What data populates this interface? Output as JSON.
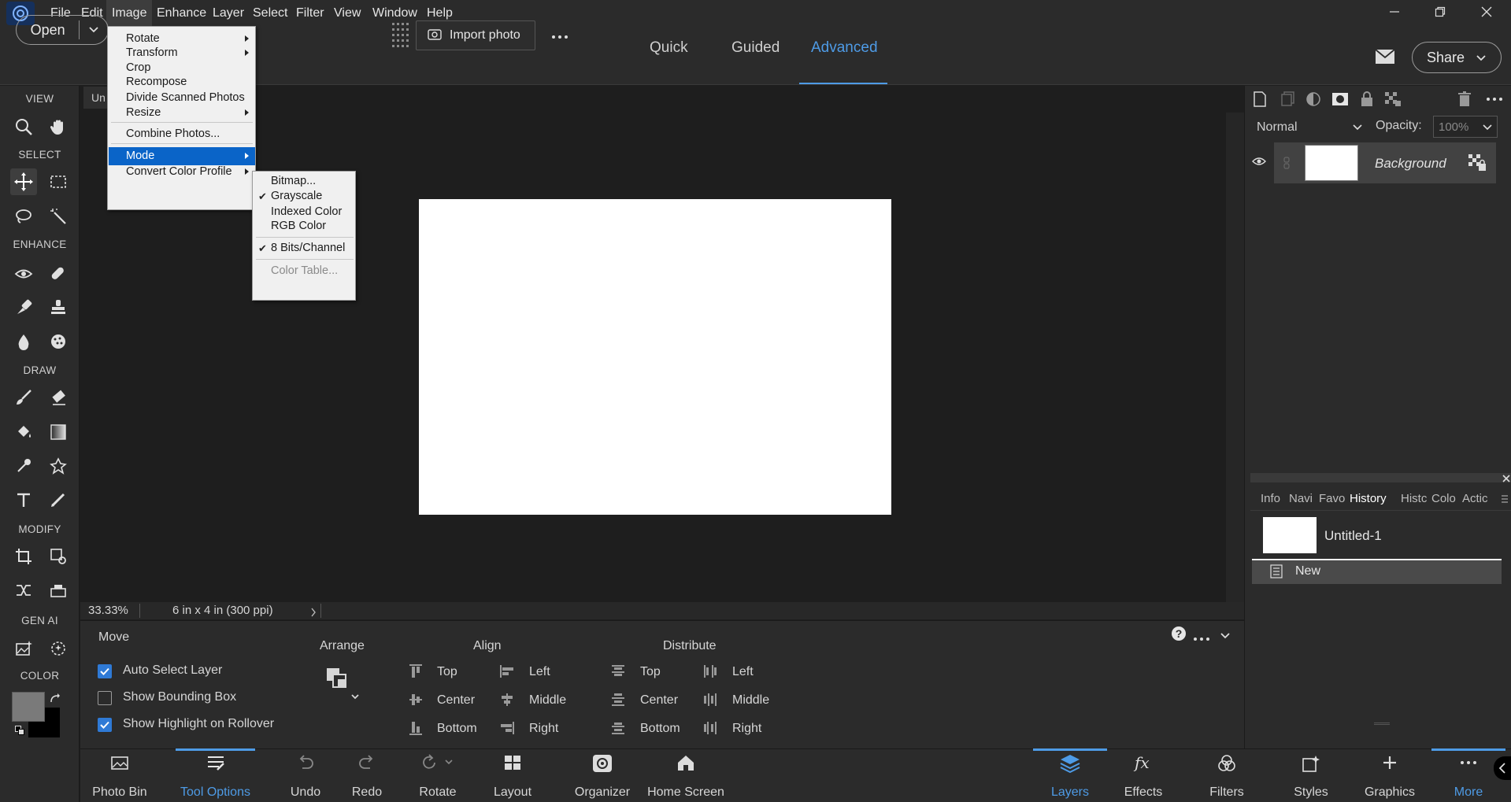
{
  "menubar": {
    "items": [
      "File",
      "Edit",
      "Image",
      "Enhance",
      "Layer",
      "Select",
      "Filter",
      "View",
      "Window",
      "Help"
    ]
  },
  "topbar": {
    "open_label": "Open",
    "import_label": "Import photo",
    "modes": [
      "Quick",
      "Guided",
      "Advanced"
    ],
    "share_label": "Share"
  },
  "toolbox": {
    "sections": [
      "VIEW",
      "SELECT",
      "ENHANCE",
      "DRAW",
      "MODIFY",
      "GEN AI",
      "COLOR"
    ]
  },
  "document": {
    "tab_label": "Un",
    "zoom": "33.33%",
    "doc_size": "6 in x 4 in (300 ppi)"
  },
  "layers_panel": {
    "blend_mode": "Normal",
    "opacity_label": "Opacity:",
    "opacity_value": "100%",
    "layer_name": "Background"
  },
  "panel_tabs": [
    "Info",
    "Navi",
    "Favo",
    "History",
    "Histc",
    "Colo",
    "Actic"
  ],
  "history": {
    "doc_name": "Untitled-1",
    "entry": "New"
  },
  "tool_options": {
    "title": "Move",
    "auto_select": "Auto Select Layer",
    "bounding_box": "Show Bounding Box",
    "highlight": "Show Highlight on Rollover",
    "arrange": "Arrange",
    "align": "Align",
    "distribute": "Distribute",
    "align_col1": [
      "Top",
      "Center",
      "Bottom"
    ],
    "align_col2": [
      "Left",
      "Middle",
      "Right"
    ],
    "dist_col1": [
      "Top",
      "Center",
      "Bottom"
    ],
    "dist_col2": [
      "Left",
      "Middle",
      "Right"
    ]
  },
  "bottombar": {
    "left": [
      "Photo Bin",
      "Tool Options",
      "Undo",
      "Redo",
      "Rotate",
      "Layout",
      "Organizer",
      "Home Screen"
    ],
    "right": [
      "Layers",
      "Effects",
      "Filters",
      "Styles",
      "Graphics",
      "More"
    ]
  },
  "image_menu": {
    "items": [
      "Rotate",
      "Transform",
      "Crop",
      "Recompose",
      "Divide Scanned Photos",
      "Resize",
      "Combine Photos...",
      "Mode",
      "Convert Color Profile"
    ]
  },
  "mode_menu": {
    "items": [
      "Bitmap...",
      "Grayscale",
      "Indexed Color",
      "RGB Color",
      "8 Bits/Channel",
      "Color Table..."
    ]
  },
  "colors": {
    "accent": "#4e9be6",
    "menu_highlight": "#0a64c8",
    "panel_bg": "#2b2b2b",
    "canvas_bg": "#1e1e1e"
  }
}
